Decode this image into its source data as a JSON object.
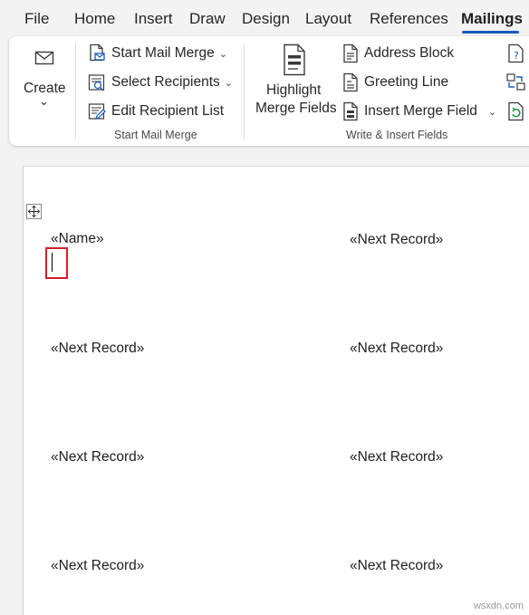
{
  "tabs": [
    {
      "label": "File"
    },
    {
      "label": "Home"
    },
    {
      "label": "Insert"
    },
    {
      "label": "Draw"
    },
    {
      "label": "Design"
    },
    {
      "label": "Layout"
    },
    {
      "label": "References"
    },
    {
      "label": "Mailings",
      "active": true
    }
  ],
  "ribbon": {
    "create": {
      "label": "Create",
      "chevron": "⌄"
    },
    "start_mail_merge": {
      "group_label": "Start Mail Merge",
      "start_mail_merge_label": "Start Mail Merge",
      "select_recipients_label": "Select Recipients",
      "edit_recipient_list_label": "Edit Recipient List"
    },
    "write_insert": {
      "group_label": "Write & Insert Fields",
      "highlight_line1": "Highlight",
      "highlight_line2": "Merge Fields",
      "address_block_label": "Address Block",
      "greeting_line_label": "Greeting Line",
      "insert_merge_field_label": "Insert Merge Field"
    }
  },
  "document": {
    "fields": [
      {
        "text": "«Name»"
      },
      {
        "text": "«Next Record»"
      },
      {
        "text": "«Next Record»"
      },
      {
        "text": "«Next Record»"
      },
      {
        "text": "«Next Record»"
      },
      {
        "text": "«Next Record»"
      },
      {
        "text": "«Next Record»"
      },
      {
        "text": "«Next Record»"
      }
    ]
  },
  "watermark": "wsxdn.com",
  "colors": {
    "accent": "#185abd",
    "highlight_box": "#d0202a",
    "ribbon_bg": "#ffffff",
    "window_bg": "#f3f3f3"
  }
}
